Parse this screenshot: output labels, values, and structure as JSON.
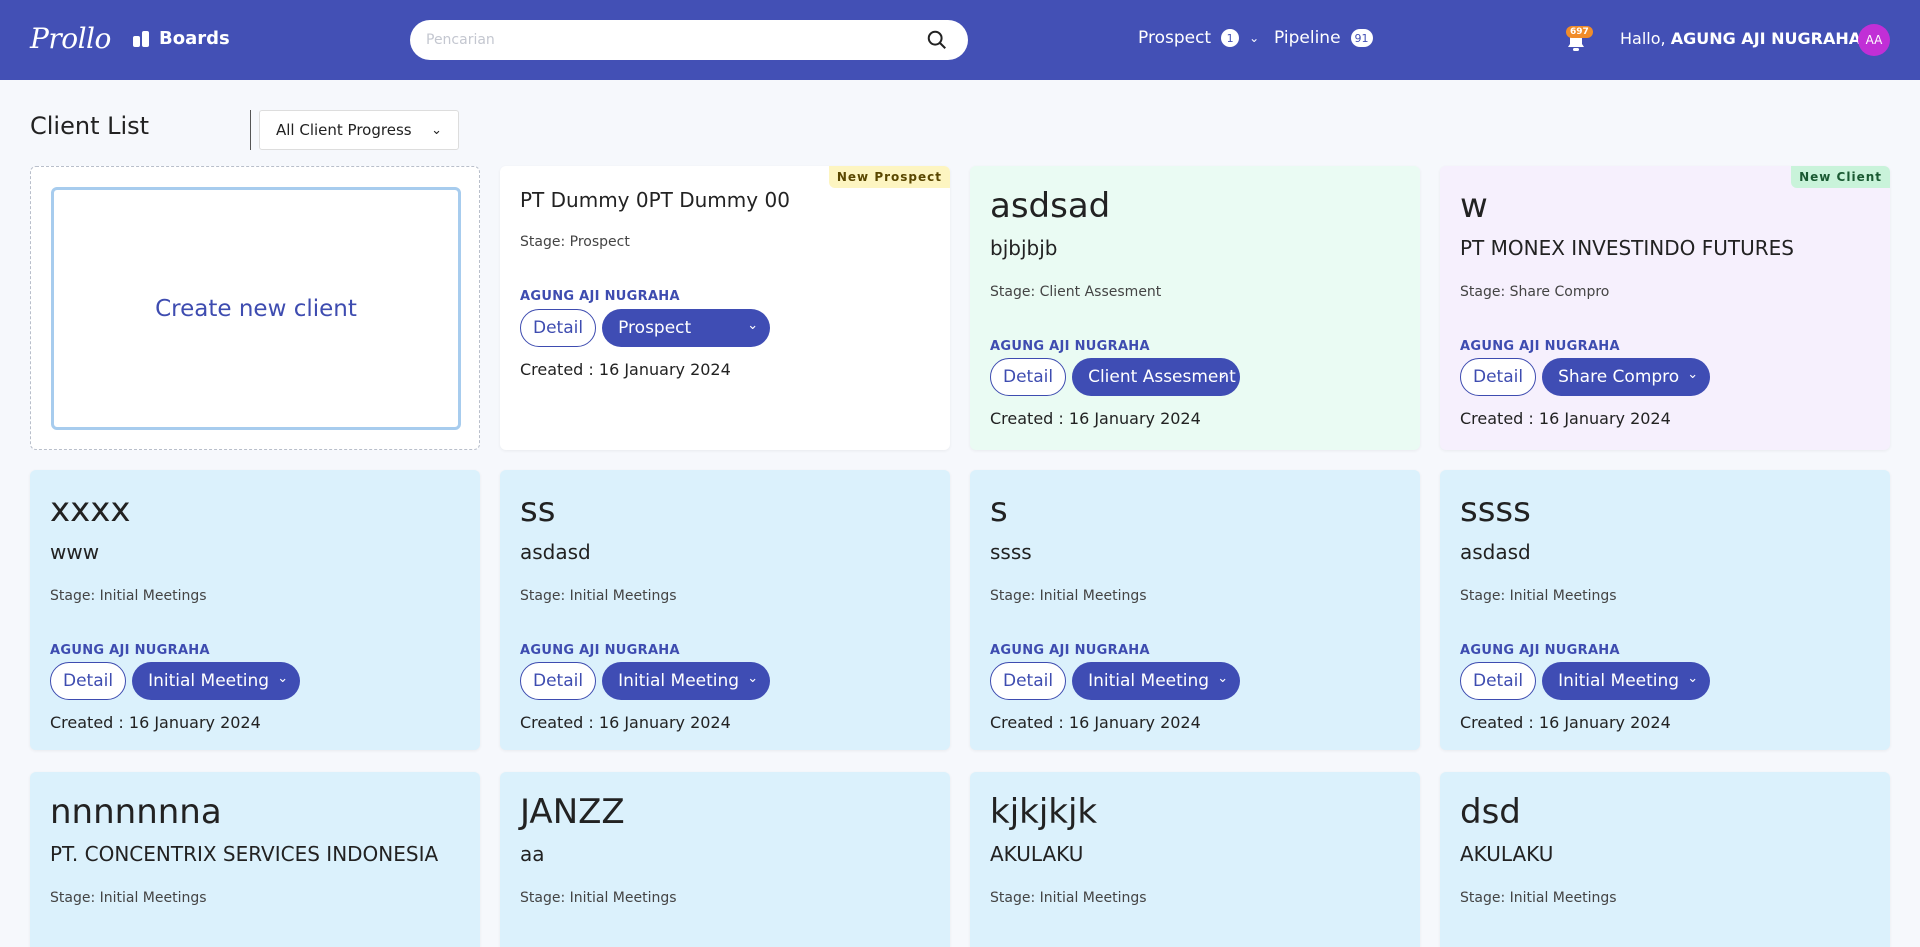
{
  "header": {
    "logo": "Prollo",
    "boards_label": "Boards",
    "search_placeholder": "Pencarian",
    "nav": [
      {
        "label": "Prospect",
        "badge": "1"
      },
      {
        "label": "Pipeline",
        "badge": "91"
      }
    ],
    "notif_count": "697",
    "greeting": "Hallo,",
    "user_name": "AGUNG AJI NUGRAHA",
    "avatar_initials": "AA"
  },
  "toolbar": {
    "title": "Client List",
    "filter_selected": "All Client Progress"
  },
  "create_label": "Create new client",
  "cards": [
    {
      "title": "PT Dummy 0PT Dummy 00",
      "subtitle": "",
      "stage": "Stage: Prospect",
      "owner": "AGUNG AJI NUGRAHA",
      "detail": "Detail",
      "select": "Prospect",
      "created": "Created : 16 January 2024",
      "ribbon": "New Prospect"
    },
    {
      "title": "asdsad",
      "subtitle": "bjbjbjb",
      "stage": "Stage: Client Assesment",
      "owner": "AGUNG AJI NUGRAHA",
      "detail": "Detail",
      "select": "Client Assesment",
      "created": "Created : 16 January 2024",
      "ribbon": ""
    },
    {
      "title": "w",
      "subtitle": "PT MONEX INVESTINDO FUTURES",
      "stage": "Stage: Share Compro",
      "owner": "AGUNG AJI NUGRAHA",
      "detail": "Detail",
      "select": "Share Compro",
      "created": "Created : 16 January 2024",
      "ribbon": "New Client"
    },
    {
      "title": "xxxx",
      "subtitle": "www",
      "stage": "Stage: Initial Meetings",
      "owner": "AGUNG AJI NUGRAHA",
      "detail": "Detail",
      "select": "Initial Meeting",
      "created": "Created : 16 January 2024",
      "ribbon": ""
    },
    {
      "title": "ss",
      "subtitle": "asdasd",
      "stage": "Stage: Initial Meetings",
      "owner": "AGUNG AJI NUGRAHA",
      "detail": "Detail",
      "select": "Initial Meeting",
      "created": "Created : 16 January 2024",
      "ribbon": ""
    },
    {
      "title": "s",
      "subtitle": "ssss",
      "stage": "Stage: Initial Meetings",
      "owner": "AGUNG AJI NUGRAHA",
      "detail": "Detail",
      "select": "Initial Meeting",
      "created": "Created : 16 January 2024",
      "ribbon": ""
    },
    {
      "title": "ssss",
      "subtitle": "asdasd",
      "stage": "Stage: Initial Meetings",
      "owner": "AGUNG AJI NUGRAHA",
      "detail": "Detail",
      "select": "Initial Meeting",
      "created": "Created : 16 January 2024",
      "ribbon": ""
    },
    {
      "title": "nnnnnnna",
      "subtitle": "PT. CONCENTRIX SERVICES INDONESIA",
      "stage": "Stage: Initial Meetings"
    },
    {
      "title": "JANZZ",
      "subtitle": "aa",
      "stage": "Stage: Initial Meetings"
    },
    {
      "title": "kjkjkjk",
      "subtitle": "AKULAKU",
      "stage": "Stage: Initial Meetings"
    },
    {
      "title": "dsd",
      "subtitle": "AKULAKU",
      "stage": "Stage: Initial Meetings"
    }
  ]
}
